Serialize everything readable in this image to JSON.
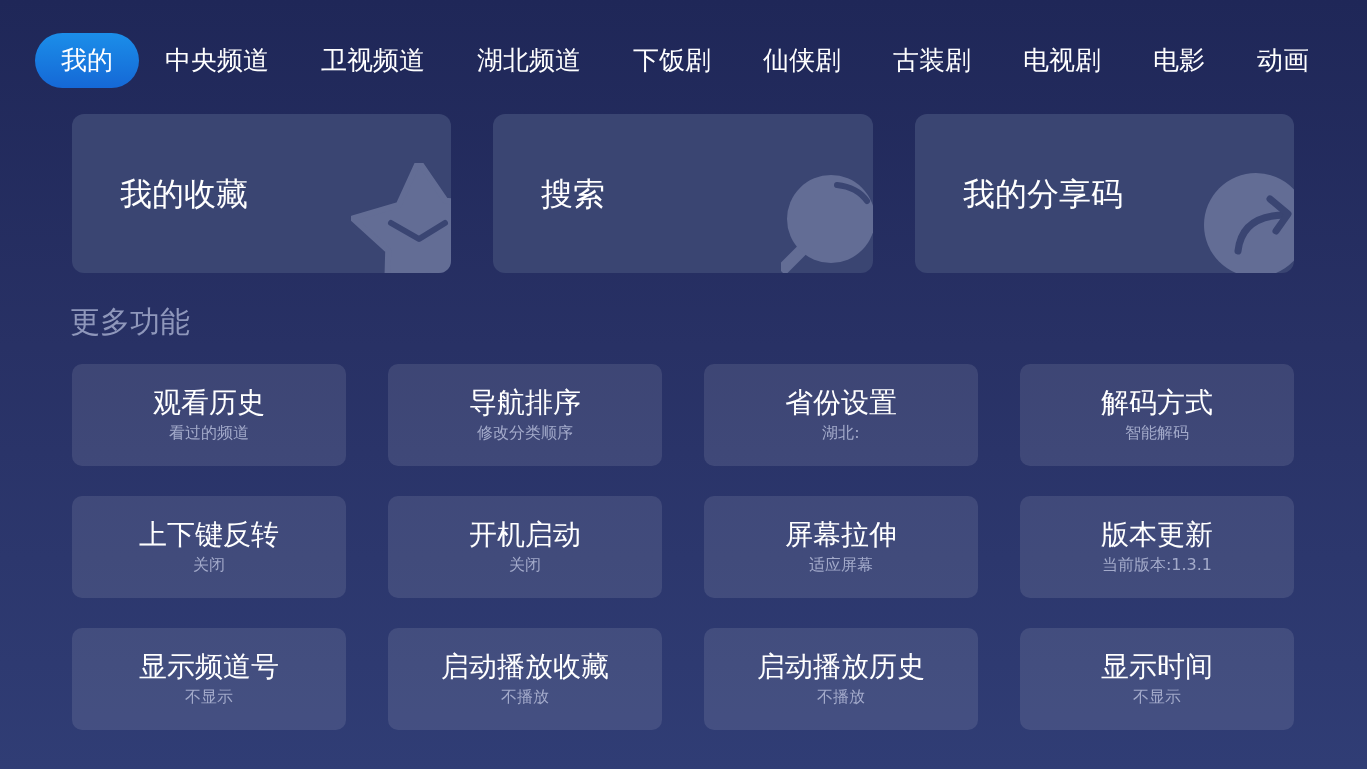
{
  "tabs": [
    {
      "label": "我的",
      "selected": true
    },
    {
      "label": "中央频道",
      "selected": false
    },
    {
      "label": "卫视频道",
      "selected": false
    },
    {
      "label": "湖北频道",
      "selected": false
    },
    {
      "label": "下饭剧",
      "selected": false
    },
    {
      "label": "仙侠剧",
      "selected": false
    },
    {
      "label": "古装剧",
      "selected": false
    },
    {
      "label": "电视剧",
      "selected": false
    },
    {
      "label": "电影",
      "selected": false
    },
    {
      "label": "动画",
      "selected": false
    }
  ],
  "shortcuts": [
    {
      "kind": "favorites",
      "label": "我的收藏"
    },
    {
      "kind": "search",
      "label": "搜索"
    },
    {
      "kind": "share",
      "label": "我的分享码"
    }
  ],
  "more_functions": {
    "title": "更多功能",
    "settings": [
      {
        "title": "观看历史",
        "value": "看过的频道"
      },
      {
        "title": "导航排序",
        "value": "修改分类顺序"
      },
      {
        "title": "省份设置",
        "value": "湖北:"
      },
      {
        "title": "解码方式",
        "value": "智能解码"
      },
      {
        "title": "上下键反转",
        "value": "关闭"
      },
      {
        "title": "开机启动",
        "value": "关闭"
      },
      {
        "title": "屏幕拉伸",
        "value": "适应屏幕"
      },
      {
        "title": "版本更新",
        "value": "当前版本:1.3.1"
      },
      {
        "title": "显示频道号",
        "value": "不显示"
      },
      {
        "title": "启动播放收藏",
        "value": "不播放"
      },
      {
        "title": "启动播放历史",
        "value": "不播放"
      },
      {
        "title": "显示时间",
        "value": "不显示"
      }
    ]
  }
}
